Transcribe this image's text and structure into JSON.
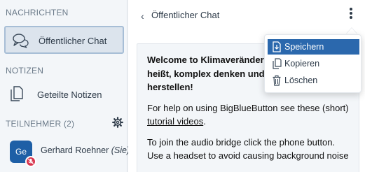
{
  "sidebar": {
    "messages_header": "NACHRICHTEN",
    "public_chat_label": "Öffentlicher Chat",
    "notes_header": "NOTIZEN",
    "shared_notes_label": "Geteilte Notizen",
    "participants_header": "TEILNEHMER (2)",
    "user": {
      "initials": "Ge",
      "name": "Gerhard Roehner",
      "role_suffix": "(Sie)"
    }
  },
  "panel": {
    "title": "Öffentlicher Chat",
    "message": {
      "welcome_prefix": "Welcome to ",
      "welcome_bold": "Klimaveränderu",
      "line2": "heißt, komplex denken und",
      "line3": "herstellen!",
      "help_text": "For help on using BigBlueButton see these (short) ",
      "help_link": "tutorial videos",
      "help_end": ".",
      "audio_line1": "To join the audio bridge click the phone button.",
      "audio_line2": "Use a headset to avoid causing background noise"
    }
  },
  "menu": {
    "items": [
      {
        "label": "Speichern",
        "icon": "save-icon",
        "active": true
      },
      {
        "label": "Kopieren",
        "icon": "copy-icon",
        "active": false
      },
      {
        "label": "Löschen",
        "icon": "trash-icon",
        "active": false
      }
    ]
  },
  "colors": {
    "accent": "#2b68ad",
    "avatar": "#1e5fa6",
    "muted_badge": "#d8344d",
    "selected_bg": "#dce4ed"
  }
}
